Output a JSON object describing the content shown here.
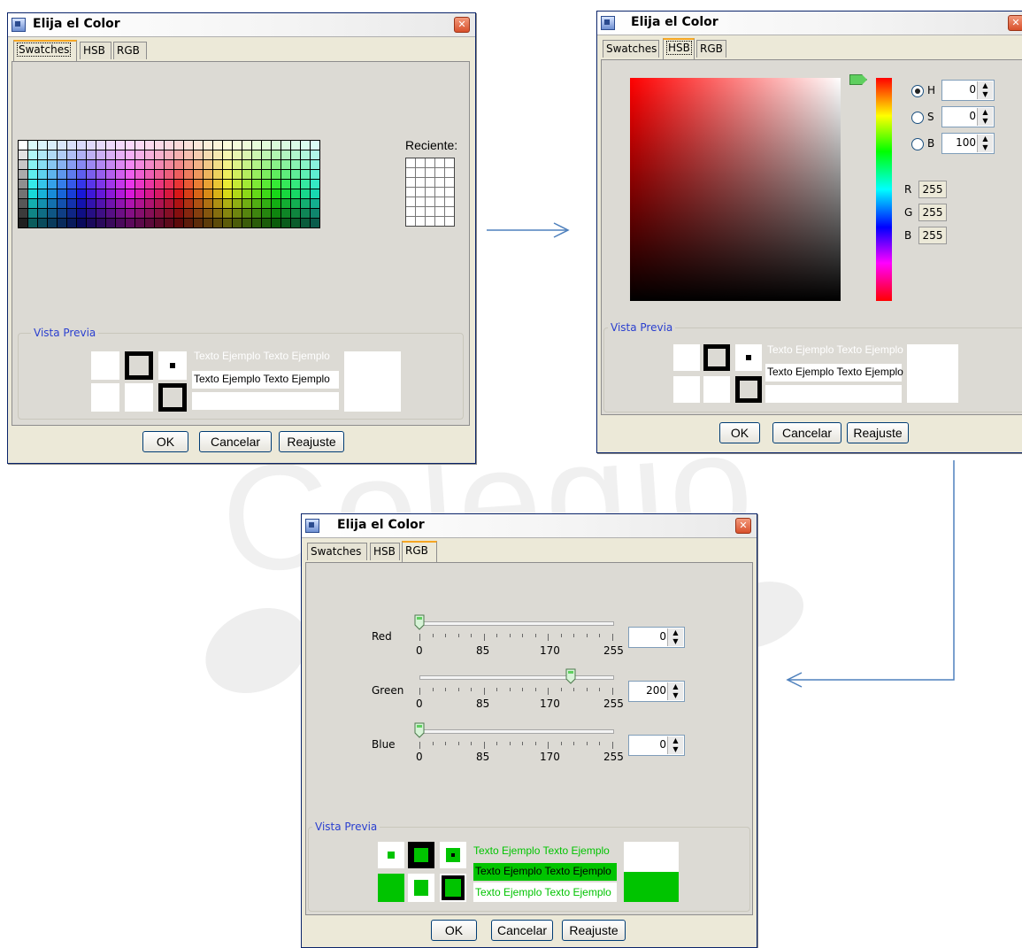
{
  "watermark_text": "Colegio",
  "dialog_title": "Elija el Color",
  "close_glyph": "✕",
  "tabs": [
    "Swatches",
    "HSB",
    "RGB"
  ],
  "preview_legend": "Vista Previa",
  "recent_label": "Reciente:",
  "sample_text": "Texto Ejemplo Texto Ejemplo",
  "buttons": {
    "ok": "OK",
    "cancel": "Cancelar",
    "reset": "Reajuste"
  },
  "hsb": {
    "h_label": "H",
    "s_label": "S",
    "b_label": "B",
    "h": "0",
    "s": "0",
    "b": "100",
    "selected": "H",
    "r_label": "R",
    "g_label": "G",
    "b2_label": "B",
    "r": "255",
    "g": "255",
    "bl": "255"
  },
  "rgb": {
    "red_label": "Red",
    "green_label": "Green",
    "blue_label": "Blue",
    "red": "0",
    "green": "200",
    "blue": "0",
    "tick_labels": [
      "0",
      "85",
      "170",
      "255"
    ],
    "max": 255
  },
  "colors": {
    "preview_green": "#00c400",
    "accent_tab": "#f5a623",
    "legend_blue": "#2a3fcf",
    "arrow": "#4f81bd"
  }
}
